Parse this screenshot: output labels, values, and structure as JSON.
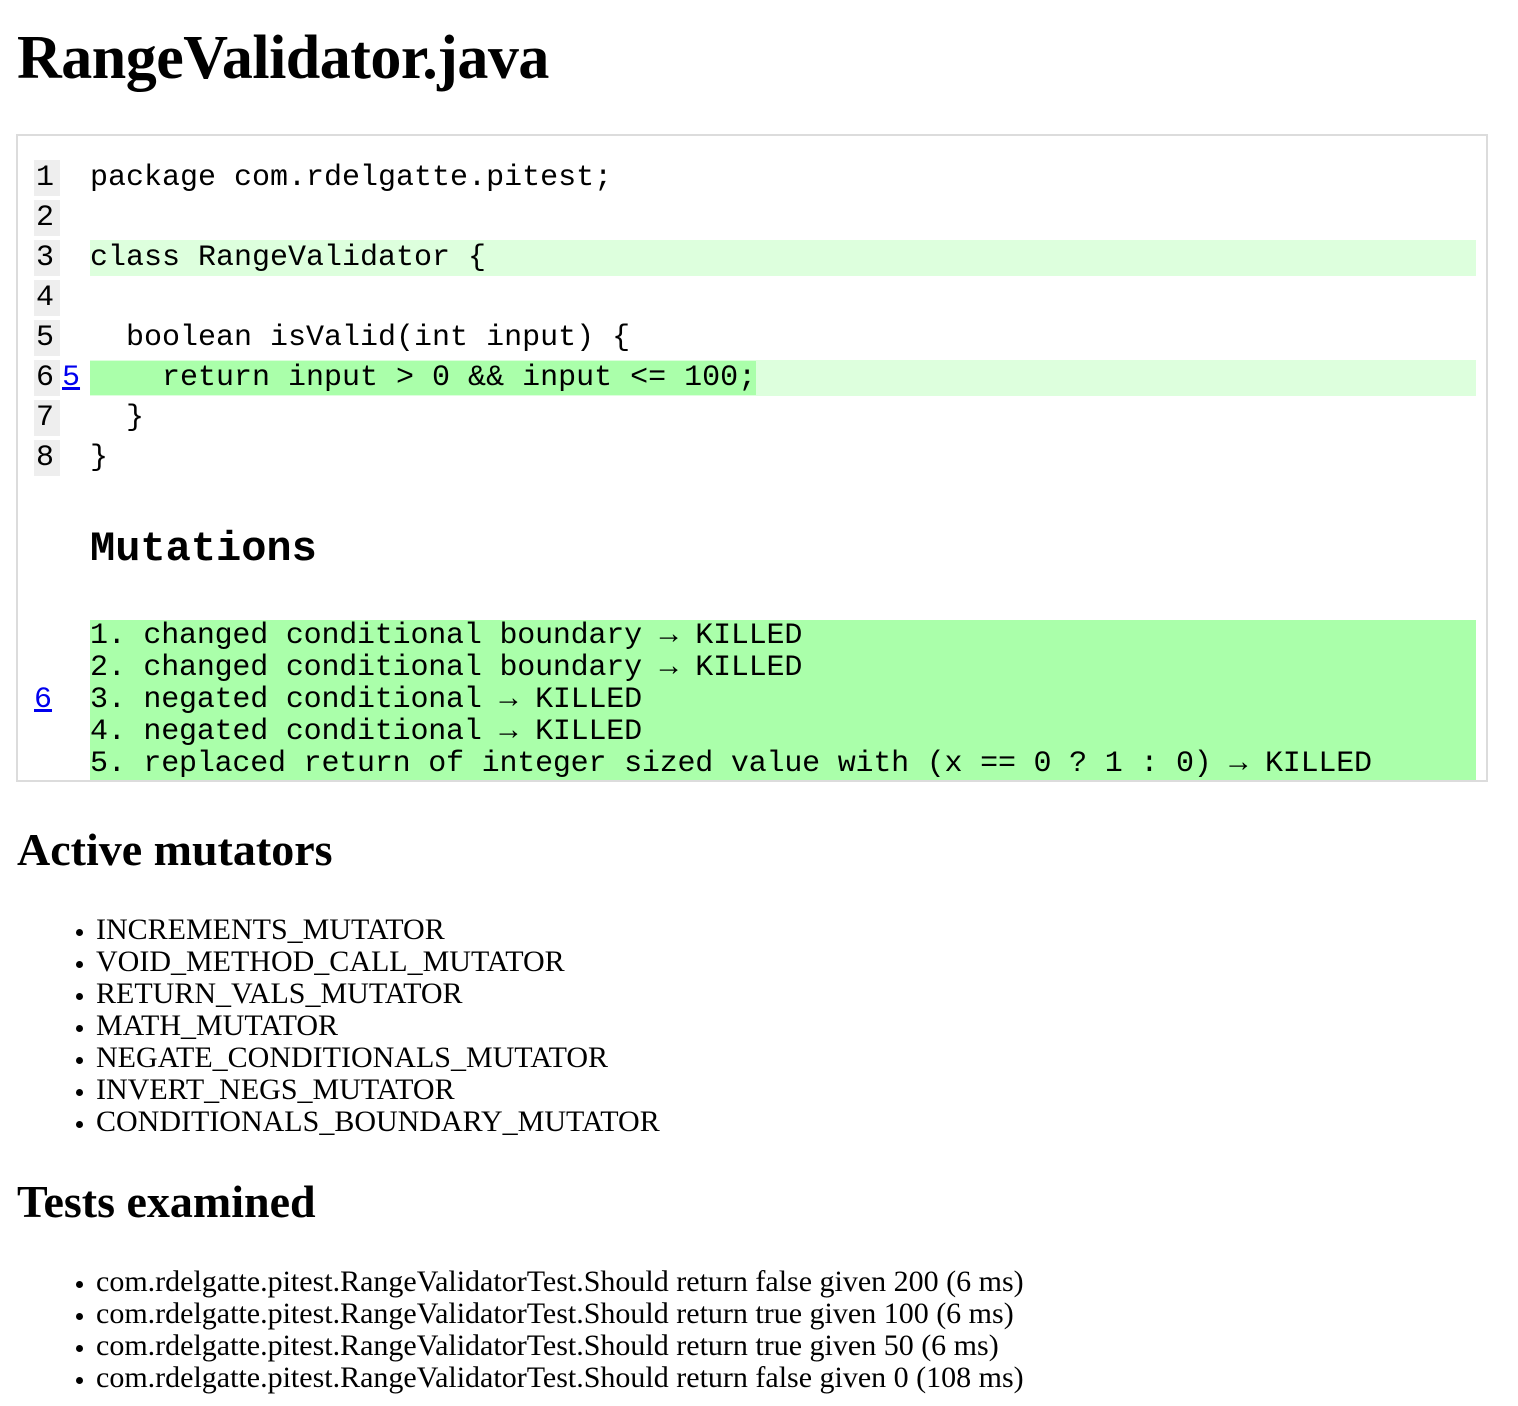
{
  "title": "RangeValidator.java",
  "code_lines": [
    {
      "num": "1",
      "mutations": "",
      "text": "package com.rdelgatte.pitest;",
      "covered": false,
      "killed": false
    },
    {
      "num": "2",
      "mutations": "",
      "text": "",
      "covered": false,
      "killed": false
    },
    {
      "num": "3",
      "mutations": "",
      "text": "class RangeValidator {",
      "covered": true,
      "killed": false
    },
    {
      "num": "4",
      "mutations": "",
      "text": "",
      "covered": false,
      "killed": false
    },
    {
      "num": "5",
      "mutations": "",
      "text": "  boolean isValid(int input) {",
      "covered": false,
      "killed": false
    },
    {
      "num": "6",
      "mutations": "5",
      "text": "    return input > 0 && input <= 100;",
      "covered": true,
      "killed": true
    },
    {
      "num": "7",
      "mutations": "",
      "text": "  }",
      "covered": false,
      "killed": false
    },
    {
      "num": "8",
      "mutations": "",
      "text": "}",
      "covered": false,
      "killed": false
    }
  ],
  "mutations_heading": "Mutations",
  "mutations_line_link": "6",
  "mutations": [
    "1. changed conditional boundary → KILLED",
    "2. changed conditional boundary → KILLED",
    "3. negated conditional → KILLED",
    "4. negated conditional → KILLED",
    "5. replaced return of integer sized value with (x == 0 ? 1 : 0) → KILLED"
  ],
  "active_mutators_heading": "Active mutators",
  "active_mutators": [
    "INCREMENTS_MUTATOR",
    "VOID_METHOD_CALL_MUTATOR",
    "RETURN_VALS_MUTATOR",
    "MATH_MUTATOR",
    "NEGATE_CONDITIONALS_MUTATOR",
    "INVERT_NEGS_MUTATOR",
    "CONDITIONALS_BOUNDARY_MUTATOR"
  ],
  "tests_heading": "Tests examined",
  "tests": [
    "com.rdelgatte.pitest.RangeValidatorTest.Should return false given 200 (6 ms)",
    "com.rdelgatte.pitest.RangeValidatorTest.Should return true given 100 (6 ms)",
    "com.rdelgatte.pitest.RangeValidatorTest.Should return true given 50 (6 ms)",
    "com.rdelgatte.pitest.RangeValidatorTest.Should return false given 0 (108 ms)"
  ],
  "colors": {
    "covered_line": "#ddffdd",
    "killed_mutation": "#aaffaa",
    "line_number_bg": "#eeeeee",
    "link": "#0000ee"
  }
}
